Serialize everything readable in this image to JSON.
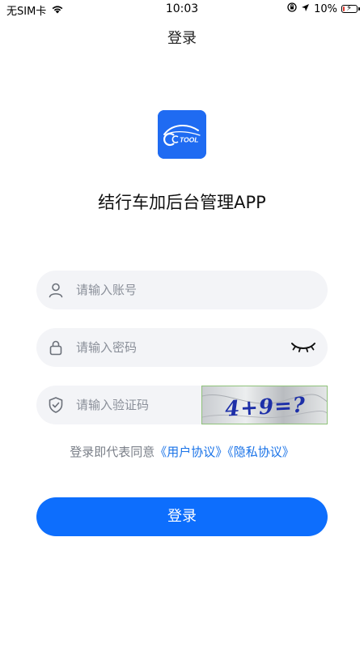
{
  "status_bar": {
    "carrier": "无SIM卡",
    "time": "10:03",
    "battery": "10%",
    "battery_level": 0.1,
    "icons": [
      "wifi-icon",
      "orientation-lock-icon",
      "location-icon",
      "battery-icon",
      "charging-icon"
    ]
  },
  "nav": {
    "title": "登录"
  },
  "logo": {
    "text": "TOOL",
    "icon": "car-logo-icon"
  },
  "app_name": "结行车加后台管理APP",
  "form": {
    "account": {
      "placeholder": "请输入账号",
      "value": "",
      "icon": "user-icon"
    },
    "password": {
      "placeholder": "请输入密码",
      "value": "",
      "icon": "lock-icon",
      "toggle_icon": "eye-closed-icon"
    },
    "captcha": {
      "placeholder": "请输入验证码",
      "value": "",
      "icon": "shield-check-icon",
      "image_text": "4+9=?"
    }
  },
  "agreement": {
    "prefix": "登录即代表同意",
    "user_agreement": "《用户协议》",
    "privacy_agreement": "《隐私协议》"
  },
  "login_button": {
    "label": "登录"
  },
  "colors": {
    "primary": "#0d6efd",
    "link": "#1a73e8",
    "input_bg": "#f3f4f7",
    "logo_bg": "#1f6bf2"
  }
}
